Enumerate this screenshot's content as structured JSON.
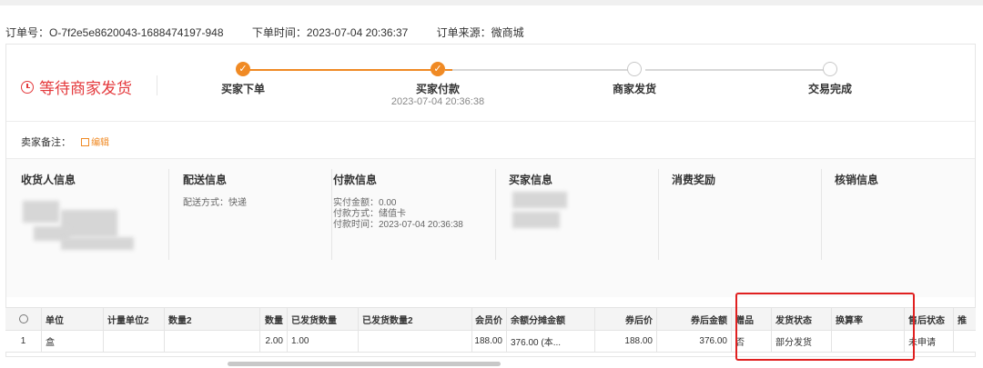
{
  "order": {
    "order_no": "订单号：O-7f2e5e8620043-1688474197-948",
    "order_time": "下单时间：2023-07-04 20:36:37",
    "order_source": "订单来源：微商城"
  },
  "status": {
    "text": "等待商家发货"
  },
  "steps": [
    {
      "label": "买家下单",
      "time": "",
      "done": true
    },
    {
      "label": "买家付款",
      "time": "2023-07-04 20:36:38",
      "done": true
    },
    {
      "label": "商家发货",
      "time": "",
      "done": false
    },
    {
      "label": "交易完成",
      "time": "",
      "done": false
    }
  ],
  "remark": {
    "label": "卖家备注：",
    "edit": "编辑"
  },
  "info": {
    "receiver": {
      "title": "收货人信息"
    },
    "delivery": {
      "title": "配送信息",
      "method": "配送方式：快递"
    },
    "payment": {
      "title": "付款信息",
      "amount": "实付金额：0.00",
      "method": "付款方式：储值卡",
      "time": "付款时间：2023-07-04 20:36:38"
    },
    "buyer": {
      "title": "买家信息"
    },
    "reward": {
      "title": "消费奖励"
    },
    "verify": {
      "title": "核销信息"
    }
  },
  "table": {
    "headers": [
      "单位",
      "计量单位2",
      "数量2",
      "数量",
      "已发货数量",
      "已发货数量2",
      "会员价",
      "余额分摊金额",
      "券后价",
      "券后金额",
      "赠品",
      "发货状态",
      "换算率",
      "售后状态",
      "推"
    ],
    "rows": [
      [
        "1",
        "盒",
        "",
        "",
        "2.00",
        "1.00",
        "",
        "188.00",
        "376.00 (本...",
        "188.00",
        "376.00",
        "否",
        "部分发货",
        "",
        "未申请",
        ""
      ]
    ]
  },
  "colors": {
    "accent": "#f08a24",
    "status": "#e4393c",
    "highlight": "#e02020"
  }
}
